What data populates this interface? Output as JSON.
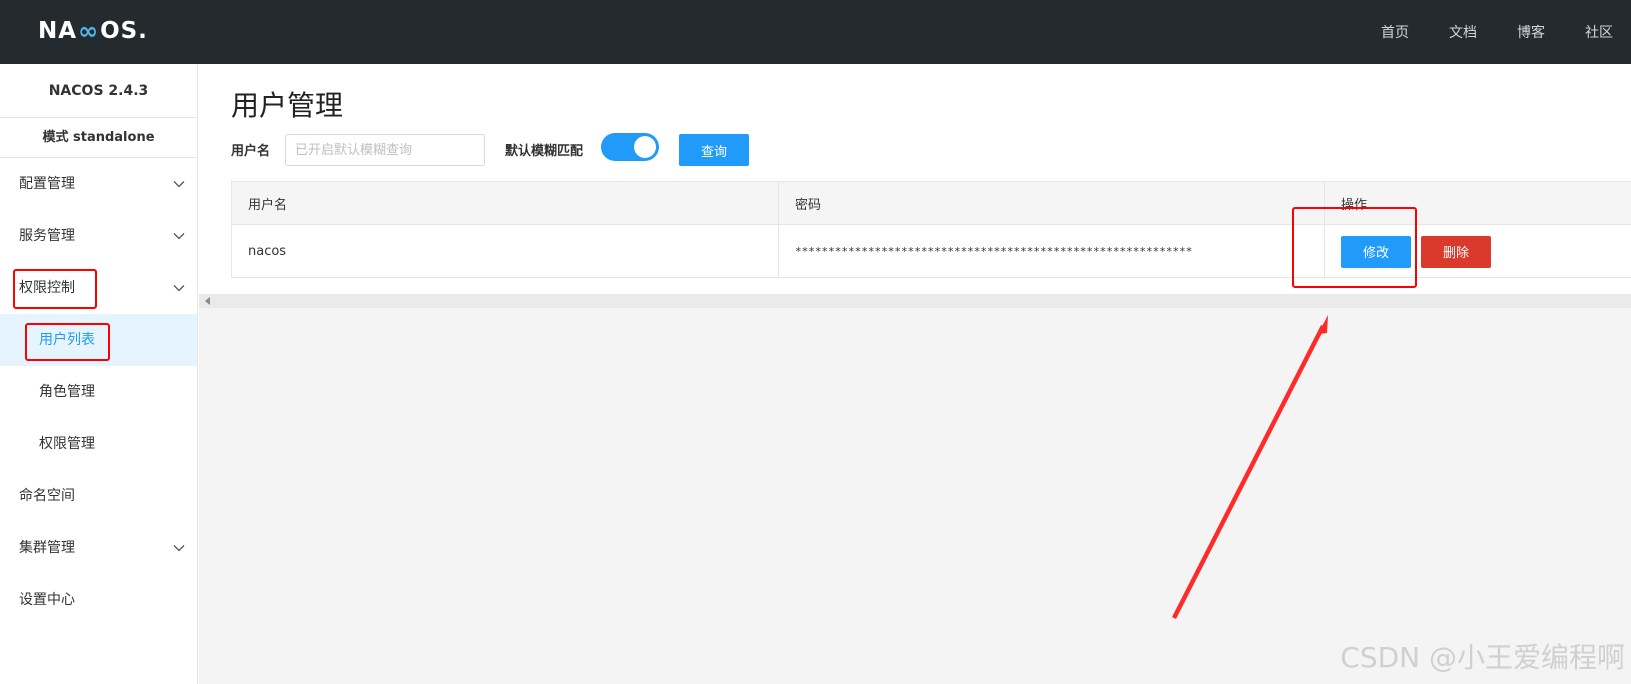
{
  "header": {
    "logo": {
      "left": "NA",
      "right": "OS.",
      "mark_color": "#4fb8e6"
    },
    "nav": [
      "首页",
      "文档",
      "博客",
      "社区"
    ]
  },
  "sidebar": {
    "version": "NACOS 2.4.3",
    "mode": "模式 standalone",
    "items": [
      {
        "label": "配置管理",
        "has_children": true
      },
      {
        "label": "服务管理",
        "has_children": true
      },
      {
        "label": "权限控制",
        "has_children": true,
        "expanded": true,
        "children": [
          {
            "label": "用户列表",
            "active": true
          },
          {
            "label": "角色管理"
          },
          {
            "label": "权限管理"
          }
        ]
      },
      {
        "label": "命名空间",
        "has_children": false
      },
      {
        "label": "集群管理",
        "has_children": true
      },
      {
        "label": "设置中心",
        "has_children": false
      }
    ]
  },
  "main": {
    "title": "用户管理",
    "filter": {
      "username_label": "用户名",
      "username_placeholder": "已开启默认模糊查询",
      "fuzzy_label": "默认模糊匹配",
      "fuzzy_on": true,
      "query_button": "查询"
    },
    "table": {
      "headers": [
        "用户名",
        "密码",
        "操作"
      ],
      "rows": [
        {
          "username": "nacos",
          "password": "************************************************************",
          "edit_label": "修改",
          "delete_label": "删除"
        }
      ]
    }
  },
  "colors": {
    "accent": "#209bfa",
    "danger": "#d93a2b",
    "header_bg": "#252a2f",
    "annotation": "#ff0000"
  },
  "watermark": "CSDN @小王爱编程啊"
}
